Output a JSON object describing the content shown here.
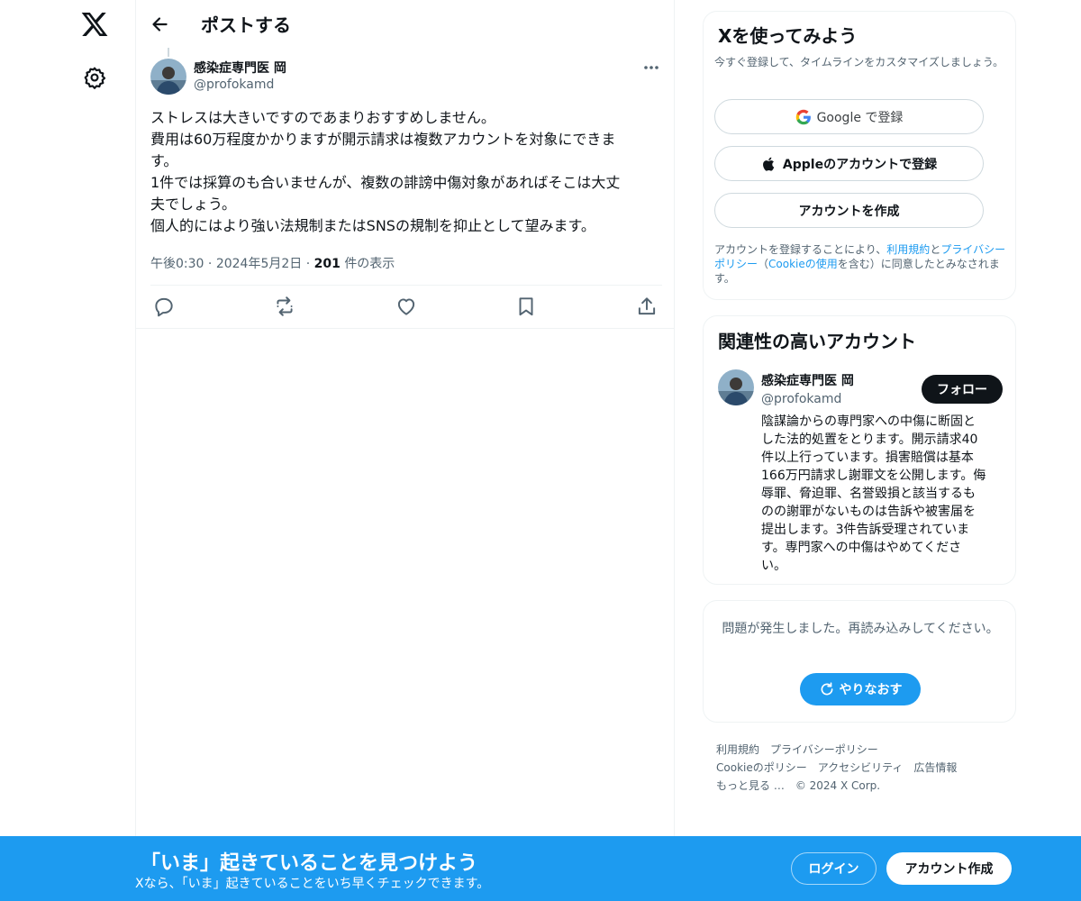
{
  "header": {
    "title": "ポストする"
  },
  "post": {
    "author_name": "感染症専門医 岡",
    "author_handle": "@profokamd",
    "lines": [
      "ストレスは大きいですのであまりおすすめしません。",
      "費用は60万程度かかりますが開示請求は複数アカウントを対象にできま",
      "す。",
      "1件では採算のも合いませんが、複数の誹謗中傷対象があればそこは大丈",
      "夫でしょう。",
      "個人的にはより強い法規制またはSNSの規制を抑止として望みます。"
    ],
    "time": "午後0:30",
    "date": "2024年5月2日",
    "views_count": "201",
    "views_label": "件の表示",
    "dot": "·"
  },
  "signup_card": {
    "title": "Xを使ってみよう",
    "subtitle": "今すぐ登録して、タイムラインをカスタマイズしましょう。",
    "google_label": "Google で登録",
    "apple_label": "Appleのアカウントで登録",
    "create_label": "アカウントを作成",
    "legal_pre": "アカウントを登録することにより、",
    "terms_link": "利用規約",
    "legal_and": "と",
    "privacy_link": "プライバシーポリシー",
    "legal_paren_open": "（",
    "cookie_link": "Cookieの使用",
    "legal_post": "を含む）に同意したとみなされます。"
  },
  "related_card": {
    "title": "関連性の高いアカウント",
    "name": "感染症専門医 岡",
    "handle": "@profokamd",
    "follow_label": "フォロー",
    "bio_lines": [
      "陰謀論からの専門家への中傷に断固と",
      "した法的処置をとります。開示請求40",
      "件以上行っています。損害賠償は基本",
      "166万円請求し謝罪文を公開します。侮",
      "辱罪、脅迫罪、名誉毀損と該当するも",
      "のの謝罪がないものは告訴や被害届を",
      "提出します。3件告訴受理されていま",
      "す。専門家への中傷はやめてくださ",
      "い。"
    ]
  },
  "error_card": {
    "message": "問題が発生しました。再読み込みしてください。",
    "retry_label": "やりなおす"
  },
  "footer": {
    "terms": "利用規約",
    "privacy": "プライバシーポリシー",
    "cookie": "Cookieのポリシー",
    "accessibility": "アクセシビリティ",
    "ads": "広告情報",
    "more": "もっと見る …",
    "copyright": "© 2024 X Corp."
  },
  "banner": {
    "title": "「いま」起きていることを見つけよう",
    "subtitle": "Xなら、「いま」起きていることをいち早くチェックできます。",
    "login_label": "ログイン",
    "signup_label": "アカウント作成"
  },
  "icons": {
    "logo": "x-logo-icon",
    "settings": "gear-icon",
    "back": "back-arrow-icon",
    "more": "more-dots-icon",
    "reply": "reply-icon",
    "repost": "repost-icon",
    "like": "heart-icon",
    "bookmark": "bookmark-icon",
    "share": "share-icon",
    "google": "google-icon",
    "apple": "apple-icon",
    "refresh": "refresh-icon"
  },
  "colors": {
    "accent": "#1d9bf0",
    "text": "#0f1419",
    "secondary": "#536471",
    "border": "#eff3f4"
  }
}
